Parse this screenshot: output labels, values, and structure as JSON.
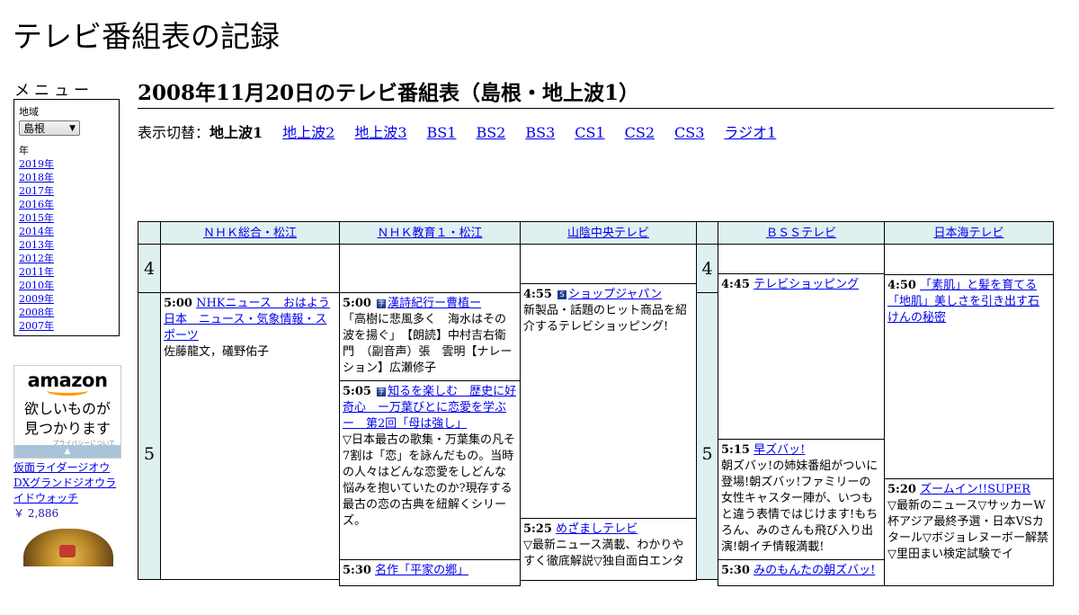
{
  "site_title": "テレビ番組表の記録",
  "menu": {
    "title": "メニュー",
    "region_label": "地域",
    "region_value": "島根",
    "year_label": "年",
    "years": [
      "2019年",
      "2018年",
      "2017年",
      "2016年",
      "2015年",
      "2014年",
      "2013年",
      "2012年",
      "2011年",
      "2010年",
      "2009年",
      "2008年",
      "2007年"
    ]
  },
  "ad": {
    "logo": "amazon",
    "copy_line1": "欲しいものが",
    "copy_line2": "見つかります",
    "privacy": "プライバシーについて",
    "product_name": "仮面ライダージオウ DXグランドジオウライドウォッチ",
    "product_price": "￥ 2,886"
  },
  "page_heading": "2008年11月20日のテレビ番組表（島根・地上波1）",
  "switcher": {
    "label": "表示切替：",
    "current": "地上波1",
    "links": [
      "地上波2",
      "地上波3",
      "BS1",
      "BS2",
      "BS3",
      "CS1",
      "CS2",
      "CS3",
      "ラジオ1"
    ]
  },
  "channels": [
    "ＮＨＫ総合・松江",
    "ＮＨＫ教育１・松江",
    "山陰中央テレビ",
    "ＢＳＳテレビ",
    "日本海テレビ"
  ],
  "hours": [
    "4",
    "5"
  ],
  "programs": {
    "nhk1_500": {
      "time": "5:00",
      "title": "NHKニュース　おはよう日本　ニュース・気象情報・スポーツ",
      "desc": "佐藤龍文，礒野佑子"
    },
    "nhke_500": {
      "time": "5:00",
      "icon": "字",
      "title": "漢詩紀行ー曹植ー",
      "desc": "「高樹に悲風多く　海水はその波を揚ぐ」　【朗読】中村吉右衛門　（副音声）張　雲明【ナレーション】広瀬修子"
    },
    "nhke_505": {
      "time": "5:05",
      "icon": "字",
      "title": "知るを楽しむ　歴史に好奇心　ー万葉びとに恋愛を学ぶー　第2回「母は強し」",
      "desc": "▽日本最古の歌集・万葉集の凡そ7割は「恋」を詠んだもの。当時の人々はどんな恋愛をしどんな悩みを抱いていたのか?現存する最古の恋の古典を紐解くシリーズ。"
    },
    "nhke_next": {
      "time": "5:30",
      "title": "名作「平家の郷」"
    },
    "fuji_455": {
      "time": "4:55",
      "icon": "S",
      "title": "ショップジャパン",
      "desc": "新製品・話題のヒット商品を紹介するテレビショッピング!"
    },
    "fuji_525": {
      "time": "5:25",
      "title": "めざましテレビ",
      "desc": "▽最新ニュース満載、わかりやすく徹底解説▽独自面白エンタ"
    },
    "bss_445": {
      "time": "4:45",
      "title": "テレビショッピング"
    },
    "bss_515": {
      "time": "5:15",
      "title": "早ズバッ!",
      "desc": "朝ズバッ!の姉妹番組がついに登場!朝ズバッ!ファミリーの女性キャスター陣が、いつもと違う表情ではじけます!もちろん、みのさんも飛び入り出演!朝イチ情報満載!"
    },
    "bss_next": {
      "time": "5:30",
      "title": "みのもんたの朝ズバッ!"
    },
    "ntv_450": {
      "time": "4:50",
      "title": "「素肌」と髪を育てる「地肌」美しさを引き出す石けんの秘密"
    },
    "ntv_520": {
      "time": "5:20",
      "title": "ズームイン!!SUPER",
      "desc": "▽最新のニュース▽サッカーW杯アジア最終予選・日本VSカタール▽ボジョレヌーボー解禁▽里田まい検定試験でイ"
    }
  }
}
